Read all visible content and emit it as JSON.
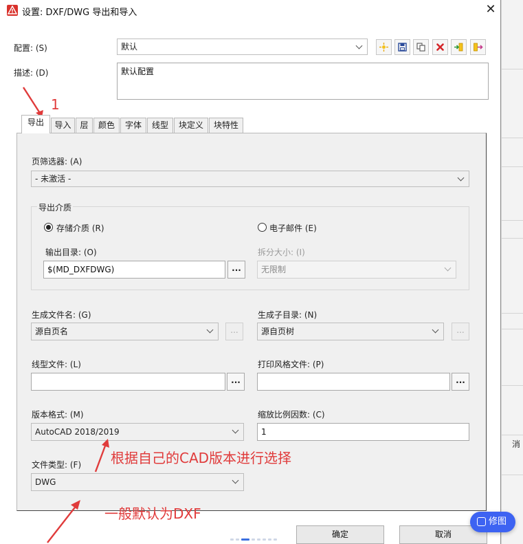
{
  "window": {
    "title": "设置: DXF/DWG 导出和导入",
    "close_glyph": "✕"
  },
  "config": {
    "label": "配置: (S)",
    "value": "默认"
  },
  "description": {
    "label": "描述: (D)",
    "value": "默认配置"
  },
  "toolbar": {
    "icons": [
      "new-icon",
      "save-icon",
      "copy-icon",
      "delete-icon",
      "import-icon",
      "export-icon"
    ]
  },
  "tabs": [
    {
      "label": "导出",
      "active": true
    },
    {
      "label": "导入"
    },
    {
      "label": "层"
    },
    {
      "label": "颜色"
    },
    {
      "label": "字体"
    },
    {
      "label": "线型"
    },
    {
      "label": "块定义"
    },
    {
      "label": "块特性"
    }
  ],
  "export": {
    "page_filter": {
      "label": "页筛选器: (A)",
      "value": "- 未激活 -"
    },
    "medium": {
      "group_label": "导出介质",
      "storage_label": "存储介质 (R)",
      "storage_checked": true,
      "email_label": "电子邮件 (E)",
      "email_checked": false,
      "output_dir_label": "输出目录: (O)",
      "output_dir_value": "$(MD_DXFDWG)",
      "split_size_label": "拆分大小: (I)",
      "split_size_value": "无限制"
    },
    "file_name": {
      "label": "生成文件名: (G)",
      "value": "源自页名"
    },
    "sub_dir": {
      "label": "生成子目录: (N)",
      "value": "源自页树"
    },
    "linetype_file": {
      "label": "线型文件: (L)",
      "value": ""
    },
    "plot_style_file": {
      "label": "打印风格文件: (P)",
      "value": ""
    },
    "version_format": {
      "label": "版本格式: (M)",
      "value": "AutoCAD 2018/2019"
    },
    "scale_factor": {
      "label": "缩放比例因数: (C)",
      "value": "1"
    },
    "file_type": {
      "label": "文件类型: (F)",
      "value": "DWG"
    }
  },
  "buttons": {
    "browse": "...",
    "ok": "确定",
    "cancel": "取消"
  },
  "annotations": {
    "step_number": "1",
    "version_hint": "根据自己的CAD版本进行选择",
    "type_hint": "一般默认为DXF"
  },
  "overlay": {
    "edit_label": "修图"
  },
  "background": {
    "clipped_text": "消"
  },
  "colors": {
    "annotation": "#e03b3b",
    "title_icon": "#d9322c",
    "overlay_pill": "#3d63f2"
  }
}
